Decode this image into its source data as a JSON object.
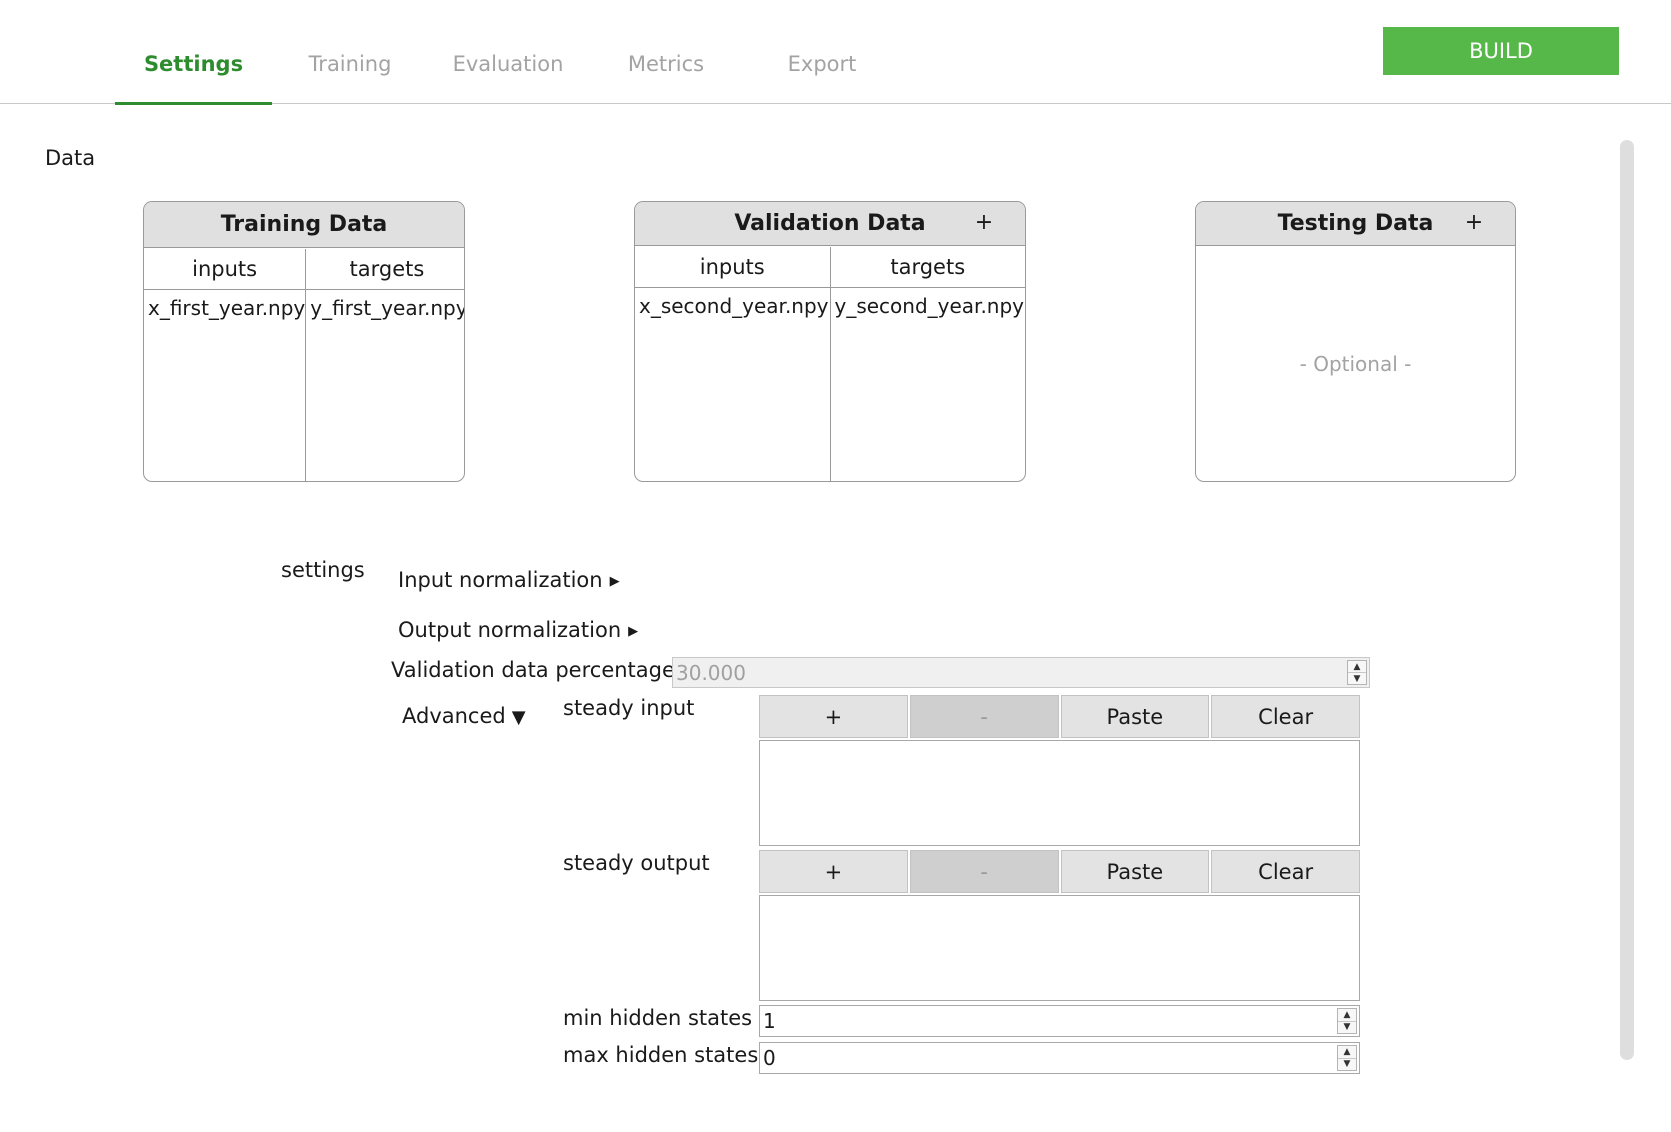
{
  "tabs": [
    {
      "label": "Settings",
      "active": true
    },
    {
      "label": "Training",
      "active": false
    },
    {
      "label": "Evaluation",
      "active": false
    },
    {
      "label": "Metrics",
      "active": false
    },
    {
      "label": "Export",
      "active": false
    }
  ],
  "build_label": "BUILD",
  "colors": {
    "accent": "#2e8b2e",
    "build": "#55b848",
    "muted": "#a3a3a3"
  },
  "data": {
    "section_title": "Data",
    "training": {
      "title": "Training Data",
      "col_inputs": "inputs",
      "col_targets": "targets",
      "inputs": [
        "x_first_year.npy"
      ],
      "targets": [
        "y_first_year.npy"
      ]
    },
    "validation": {
      "title": "Validation Data",
      "add": "+",
      "col_inputs": "inputs",
      "col_targets": "targets",
      "inputs": [
        "x_second_year.npy"
      ],
      "targets": [
        "y_second_year.npy"
      ]
    },
    "testing": {
      "title": "Testing Data",
      "add": "+",
      "placeholder": "- Optional -"
    }
  },
  "settings": {
    "label": "settings",
    "input_normalization": "Input normalization",
    "output_normalization": "Output normalization",
    "validation_pct_label": "Validation data percentage",
    "validation_pct_value": "30.000",
    "advanced_label": "Advanced",
    "steady_input_label": "steady input",
    "steady_output_label": "steady output",
    "list_buttons": {
      "add": "+",
      "remove": "-",
      "paste": "Paste",
      "clear": "Clear"
    },
    "min_hidden_label": "min hidden states",
    "min_hidden_value": "1",
    "max_hidden_label": "max hidden states",
    "max_hidden_value": "0"
  }
}
